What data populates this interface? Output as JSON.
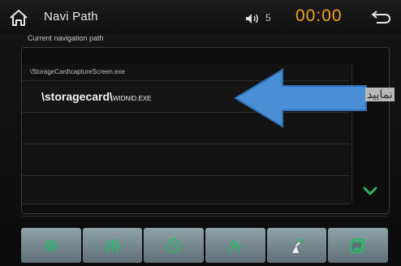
{
  "header": {
    "title": "Navi Path",
    "volume_level": "5",
    "time": "00:00",
    "icons": [
      "home-icon",
      "speaker-icon",
      "back-icon"
    ]
  },
  "path_label": "Current navigation path",
  "path_list": {
    "items": [
      "\\StorageCard\\captureScreen.exe"
    ],
    "selected": {
      "main": "\\storagecard\\",
      "suffix": "WIDNID.EXE"
    }
  },
  "annotation": {
    "text": "نمایید",
    "arrow_color": "#4a8fd6"
  },
  "bottom_bar": {
    "icons": [
      "gear-icon",
      "equalizer-icon",
      "clock-icon",
      "satellite-icon",
      "gps-antenna-icon",
      "photo-icon"
    ],
    "icon_color": "#2fb36b"
  }
}
